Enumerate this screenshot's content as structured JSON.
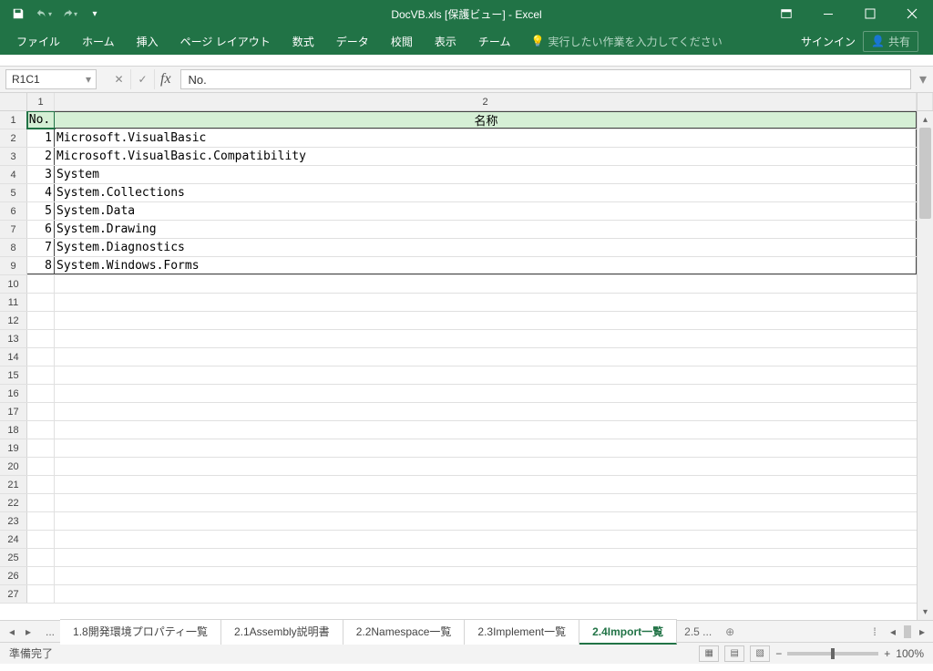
{
  "title": "DocVB.xls  [保護ビュー] - Excel",
  "ribbon": [
    "ファイル",
    "ホーム",
    "挿入",
    "ページ レイアウト",
    "数式",
    "データ",
    "校閲",
    "表示",
    "チーム"
  ],
  "tellme": "実行したい作業を入力してください",
  "signin": "サインイン",
  "share": "共有",
  "nameBox": "R1C1",
  "formula": "No.",
  "columns": [
    "1",
    "2"
  ],
  "headers": {
    "no": "No.",
    "name": "名称"
  },
  "rows": [
    {
      "no": "1",
      "name": "Microsoft.VisualBasic"
    },
    {
      "no": "2",
      "name": "Microsoft.VisualBasic.Compatibility"
    },
    {
      "no": "3",
      "name": "System"
    },
    {
      "no": "4",
      "name": "System.Collections"
    },
    {
      "no": "5",
      "name": "System.Data"
    },
    {
      "no": "6",
      "name": "System.Drawing"
    },
    {
      "no": "7",
      "name": "System.Diagnostics"
    },
    {
      "no": "8",
      "name": "System.Windows.Forms"
    }
  ],
  "emptyRowStart": 10,
  "emptyRowEnd": 27,
  "sheetTabs": [
    "1.8開発環境プロパティ一覧",
    "2.1Assembly説明書",
    "2.2Namespace一覧",
    "2.3Implement一覧",
    "2.4Import一覧"
  ],
  "sheetTabMore": "2.5",
  "activeTab": 4,
  "status": "準備完了",
  "zoom": "100%"
}
